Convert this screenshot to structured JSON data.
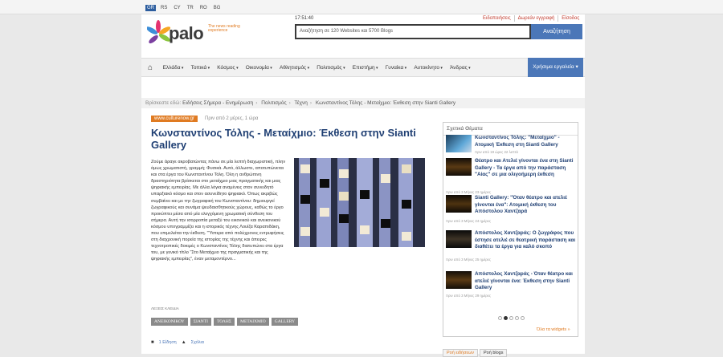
{
  "languages": [
    "GR",
    "RS",
    "CY",
    "TR",
    "RO",
    "BG"
  ],
  "logo": {
    "name": "palo",
    "tagline": "The news reading experience"
  },
  "clock": "17:51:40",
  "toplinks": [
    "Ειδοποιήσεις",
    "Δωρεάν εγγραφή",
    "Είσοδος"
  ],
  "search": {
    "placeholder": "Αναζήτηση σε 120 Websites και 5700 Blogs",
    "button": "Αναζήτηση"
  },
  "nav": {
    "items": [
      "Ελλάδα",
      "Τοπικά",
      "Κόσμος",
      "Οικονομία",
      "Αθλητισμός",
      "Πολιτισμός",
      "Επιστήμη",
      "Γυναίκα",
      "Αυτοκίνητο",
      "Άνδρας"
    ],
    "tools": "Χρήσιμα εργαλεία"
  },
  "breadcrumb": {
    "label": "Βρίσκεστε εδώ:",
    "items": [
      "Ειδήσεις Σήμερα - Ενημέρωση",
      "Πολιτισμός",
      "Τέχνη",
      "Κωνσταντίνος Τόλης - Μεταίχμιο: Έκθεση στην Sianti Gallery"
    ]
  },
  "article": {
    "source": "www.culturenow.gr",
    "time": "Πριν από 2 μέρες, 1 ώρα",
    "title": "Κωνσταντίνος Τόλης - Μεταίχμιο: Έκθεση στην Sianti Gallery",
    "body": "Ζούμε άραγε ακροβατώντας πάνω σε μία λεπτή διαχωριστική, πλην όμως χρωματιστή, γραμμή; Φυσικά. Αυτό, άλλωστε, αποτυπώνεται και στα έργα του Κωνσταντίνου Τόλη. Όλη η ανθρώπινη δραστηριότητα βρίσκεται στο μεταίχμιο μιας πραγματικής και μιας ψηφιακής εμπειρίας. Με άλλα λόγια αναμένεις στον συνειδητό υπαρξιακό κόσμο και στον ασυνείδητο ψηφιακό. Όπως ακριβώς συμβαίνει και με την ζωγραφική του Κωνσταντίνου: δημιουργεί ζωγραφικούς και συνάμα ψευδαισθητικούς χώρους, καθώς το έργο προκύπτει μέσα από μία ελεγχόμενη χρωματική σύνθεση του σήμερα. Αυτή την ισορροπία μεταξύ του εικονικού και ανεικονικού κόσμου υπογραμμίζει και η ιστορικός τέχνης Λουίζα Καραπιδάκη, που επιμελείται την έκθεση. \"Ύστερα από πολύχρονες εντρυφήσεις στη διαχρονική πορεία της ιστορίας της τέχνης και άπειρες τεχνοτροπικές δοκιμές ο Κωνσταντίνος Τόλης διατυπώνει στα έργα του, με γενικό τίτλο \"Στο Μεταίχμιο της πραγματικής και της ψηφιακής εμπειρίας\", έναν μεταμοντέρνο...",
    "author": "ΛΕΞΕΙΣ ΚΛΕΙΔΙΑ",
    "tags": [
      "ΑΝΕΙΚΟΝΙΚΟΥ",
      "ΣΙΑΝΤΙ",
      "ΤΟΛΗΣ",
      "ΜΕΤΑΙΧΜΙΟ",
      "GALLERY"
    ],
    "footer": {
      "views": "1 Είδηση",
      "share": "Σχόλια"
    }
  },
  "sidebar": {
    "heading": "Σχετικά Θέματα",
    "items": [
      {
        "title": "Κωνσταντίνος Τόλης: \"Μεταίχμιο\" - Ατομική Έκθεση στη Sianti Gallery",
        "date": "πριν από 19 ώρες 22 λεπτά"
      },
      {
        "title": "Θέατρο και Ατελιέ γίνονται ένα στη Sianti Gallery - Τα έργα από την παράσταση \"Αίας\" σε μια ολιγοήμερη έκθεση",
        "date": "πριν από 3 Μήνες 23 ημέρες"
      },
      {
        "title": "Sianti Gallery: \"Όταν θέατρο και ατελιέ γίνονται ένα\": Ατομική έκθεση του Απόστολου Χαντζαρά",
        "date": "πριν από 3 Μήνες 24 ημέρες"
      },
      {
        "title": "Απόστολος Χαντζαράς: Ο ζωγράφος που έστησε ατελιέ σε θεατρική παράσταση και διαθέτει τα έργα για καλό σκοπό",
        "date": "πριν από 3 Μήνες 25 ημέρες"
      },
      {
        "title": "Απόστολος Χαντζαράς - Όταν θέατρο και ατελιέ γίνονται ένα: Έκθεση στην Sianti Gallery",
        "date": "πριν από 3 Μήνες 29 ημέρες"
      }
    ],
    "widgets": "Όλα τα widgets »",
    "tabs": [
      "Ροή ειδήσεων",
      "Ροή blogs"
    ]
  },
  "colors": {
    "brand": "#e07b22",
    "link": "#1f3f73",
    "button": "#4b77b8"
  }
}
